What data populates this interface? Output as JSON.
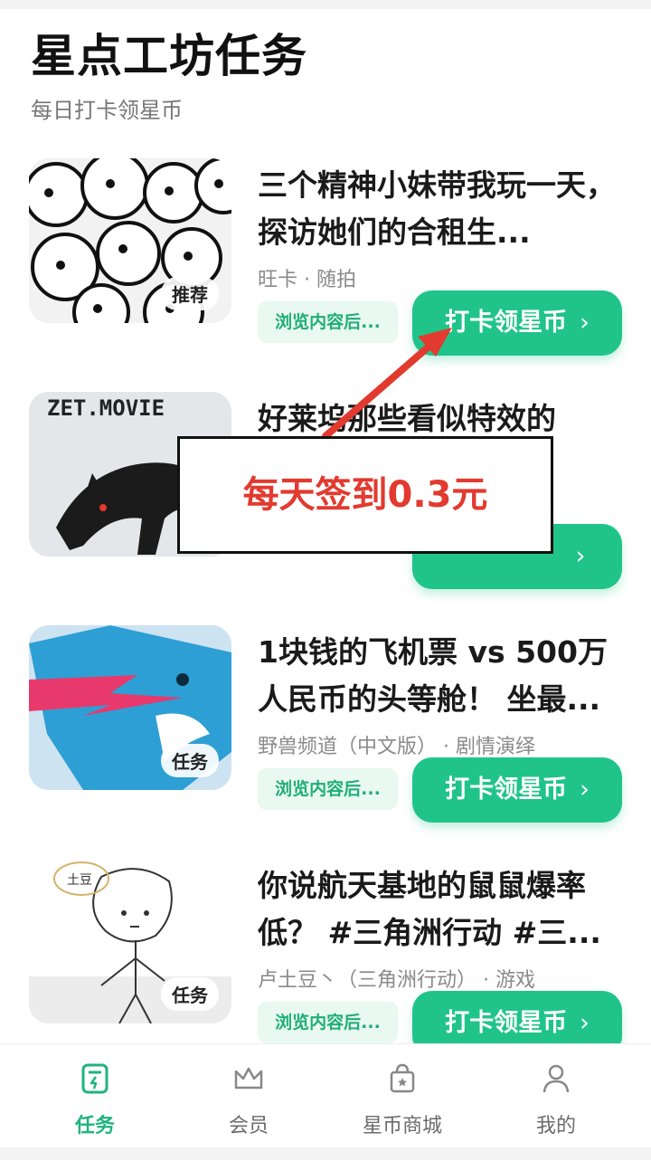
{
  "header": {
    "title": "星点工坊任务",
    "subtitle": "每日打卡领星币"
  },
  "cards": [
    {
      "title": "三个精神小妹带我玩一天，探访她们的合租生...",
      "meta": "旺卡 · 随拍",
      "badge": "推荐",
      "browse": "浏览内容后...",
      "action": "打卡领星币"
    },
    {
      "title": "好莱坞那些看似特效的实...",
      "meta": "",
      "badge": "",
      "browse": "",
      "action": ""
    },
    {
      "title": "1块钱的飞机票 vs 500万人民币的头等舱！ 坐最...",
      "meta": "野兽频道（中文版） · 剧情演绎",
      "badge": "任务",
      "browse": "浏览内容后...",
      "action": "打卡领星币"
    },
    {
      "title": "你说航天基地的鼠鼠爆率低？ #三角洲行动 #三...",
      "meta": "卢土豆丶（三角洲行动） · 游戏",
      "badge": "任务",
      "browse": "浏览内容后...",
      "action": "打卡领星币"
    }
  ],
  "thumb_texts": {
    "movie_logo": "ZET.MOVIE",
    "potato_label": "土豆"
  },
  "annotation": {
    "text": "每天签到0.3元",
    "color": "#e23a2f"
  },
  "nav": [
    {
      "label": "任务",
      "icon": "task-icon",
      "active": true
    },
    {
      "label": "会员",
      "icon": "crown-icon",
      "active": false
    },
    {
      "label": "星币商城",
      "icon": "shop-bag-icon",
      "active": false
    },
    {
      "label": "我的",
      "icon": "person-icon",
      "active": false
    }
  ],
  "colors": {
    "accent": "#20c48a",
    "annotation_red": "#e23a2f"
  }
}
